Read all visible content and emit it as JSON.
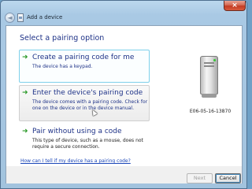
{
  "window": {
    "title": "Add a device",
    "close_label": "×",
    "back_label": "◄"
  },
  "heading": "Select a pairing option",
  "options": [
    {
      "title": "Create a pairing code for me",
      "description": "The device has a keypad.",
      "icon": "green-arrow-icon"
    },
    {
      "title": "Enter the device's pairing code",
      "description": "The device comes with a pairing code. Check for one on the device or in the device manual.",
      "icon": "green-arrow-icon"
    },
    {
      "title": "Pair without using a code",
      "description": "This type of device, such as a mouse, does not require a secure connection.",
      "icon": "green-arrow-icon"
    }
  ],
  "arrow_glyph": "➜",
  "device": {
    "label": "E06-05-16-13870",
    "icon": "device-icon"
  },
  "help_link": "How can I tell if my device has a pairing code?",
  "buttons": {
    "next": "Next",
    "cancel": "Cancel"
  },
  "colors": {
    "link_blue": "#1e3287",
    "arrow_green": "#2c9a2a",
    "highlight_border": "#7ed0ea"
  }
}
